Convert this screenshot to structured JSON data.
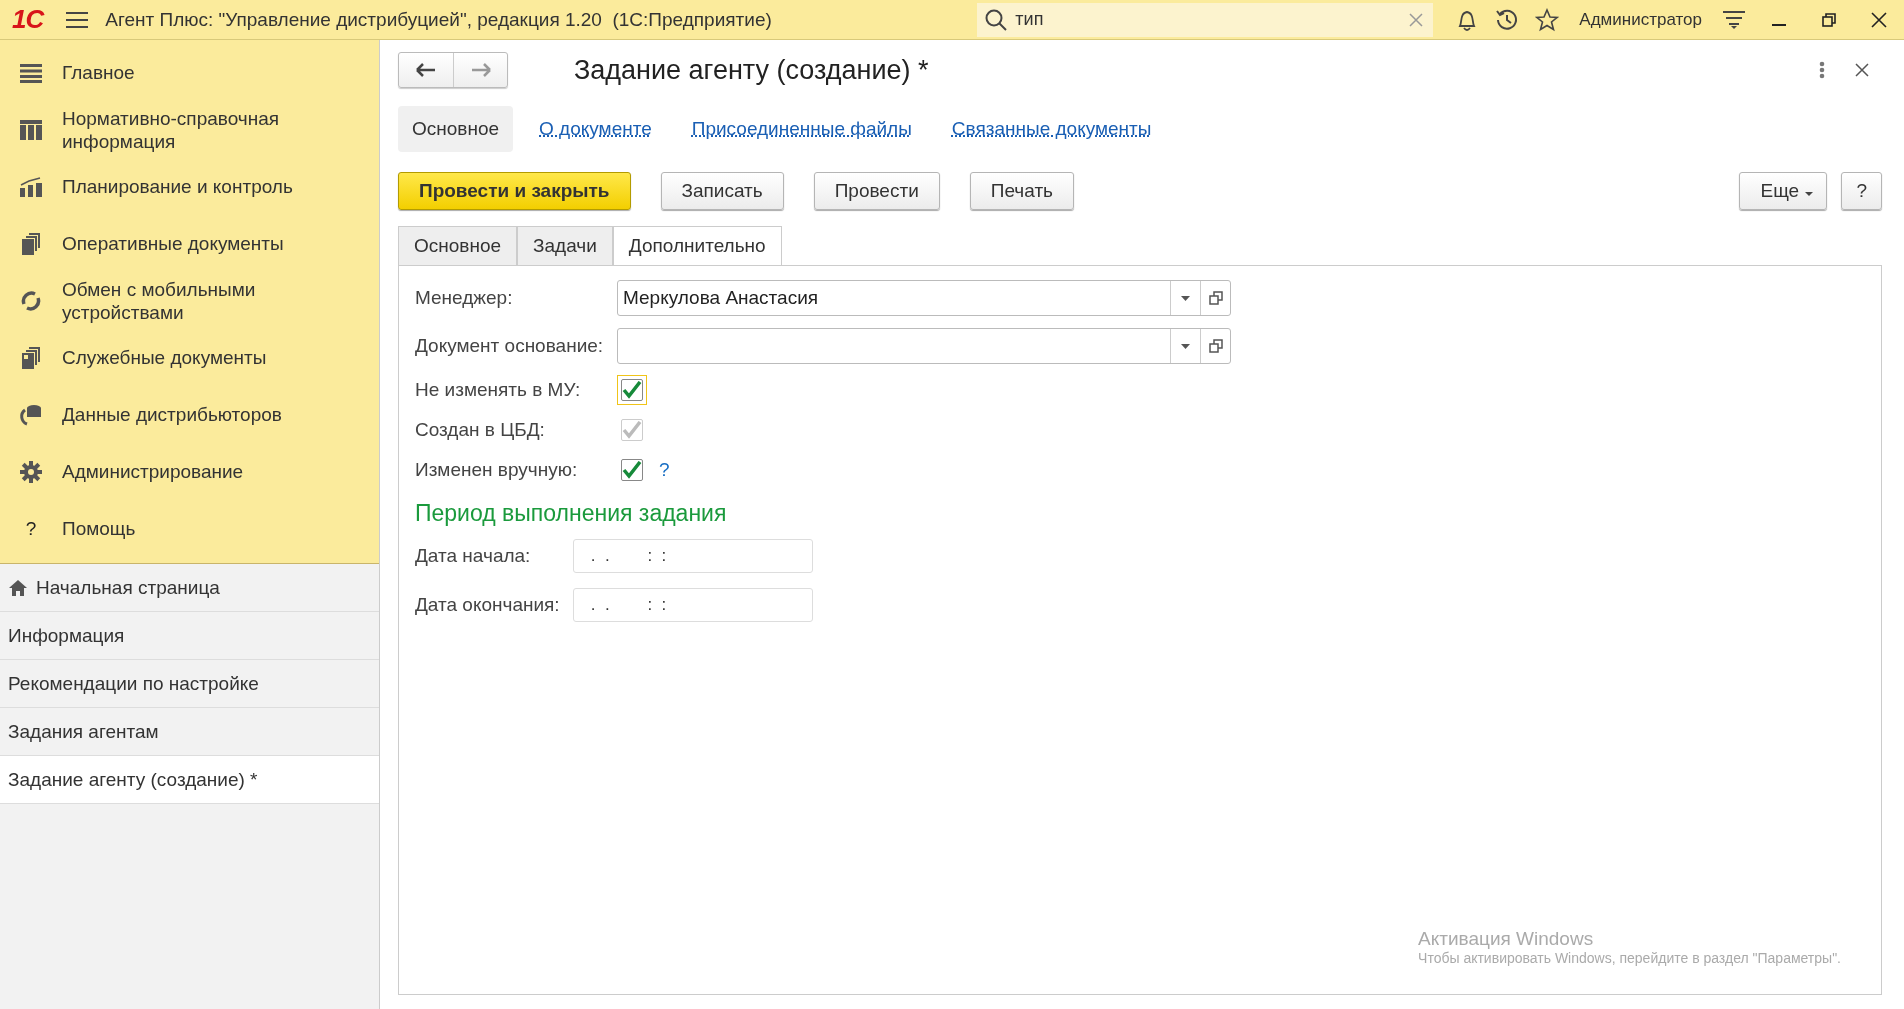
{
  "app_bar": {
    "logo": "1С",
    "title": "Агент Плюс: \"Управление дистрибуцией\", редакция 1.20  (1С:Предприятие)",
    "search": {
      "value": "тип"
    },
    "user": "Администратор"
  },
  "sections": [
    {
      "label": "Главное"
    },
    {
      "label": "Нормативно-справочная информация"
    },
    {
      "label": "Планирование и контроль"
    },
    {
      "label": "Оперативные документы"
    },
    {
      "label": "Обмен с мобильными устройствами"
    },
    {
      "label": "Служебные документы"
    },
    {
      "label": "Данные дистрибьюторов"
    },
    {
      "label": "Администрирование"
    },
    {
      "label": "Помощь",
      "glyph": "?"
    }
  ],
  "open_windows": [
    {
      "label": "Начальная страница",
      "selected": false
    },
    {
      "label": "Информация",
      "selected": false
    },
    {
      "label": "Рекомендации по настройке",
      "selected": false
    },
    {
      "label": "Задания агентам",
      "selected": false
    },
    {
      "label": "Задание агенту (создание) *",
      "selected": true
    }
  ],
  "form": {
    "title": "Задание агенту (создание) *",
    "nav_tabs": [
      {
        "label": "Основное",
        "selected": true
      },
      {
        "label": "О документе",
        "selected": false
      },
      {
        "label": "Присоединенные файлы",
        "selected": false
      },
      {
        "label": "Связанные документы",
        "selected": false
      }
    ],
    "buttons": [
      {
        "label": "Провести и закрыть",
        "kind": "primary"
      },
      {
        "label": "Записать",
        "kind": "normal"
      },
      {
        "label": "Провести",
        "kind": "normal"
      },
      {
        "label": "Печать",
        "kind": "normal"
      }
    ],
    "more_button": "Еще",
    "help_button": "?",
    "tabs": [
      {
        "label": "Основное",
        "selected": false
      },
      {
        "label": "Задачи",
        "selected": false
      },
      {
        "label": "Дополнительно",
        "selected": true
      }
    ],
    "fields": [
      {
        "kind": "select",
        "label": "Менеджер:",
        "value": "Меркулова Анастасия"
      },
      {
        "kind": "select",
        "label": "Документ основание:"
      },
      {
        "kind": "checkbox",
        "label": "Не изменять в МУ:",
        "checked": true,
        "disabled": false,
        "focused": true
      },
      {
        "kind": "checkbox",
        "label": "Создан в ЦБД:",
        "checked": true,
        "disabled": true,
        "focused": false
      },
      {
        "kind": "checkbox",
        "label": "Изменен вручную:",
        "checked": true,
        "disabled": false,
        "focused": false,
        "hint": "?"
      }
    ],
    "section_title": "Период выполнения задания",
    "dates": [
      {
        "label": "Дата начала:",
        "value": " .  .        :  :"
      },
      {
        "label": "Дата окончания:",
        "value": " .  .        :  :"
      }
    ]
  },
  "os_notice": {
    "title": "Активация Windows",
    "text": "Чтобы активировать Windows, перейдите в раздел \"Параметры\"."
  }
}
